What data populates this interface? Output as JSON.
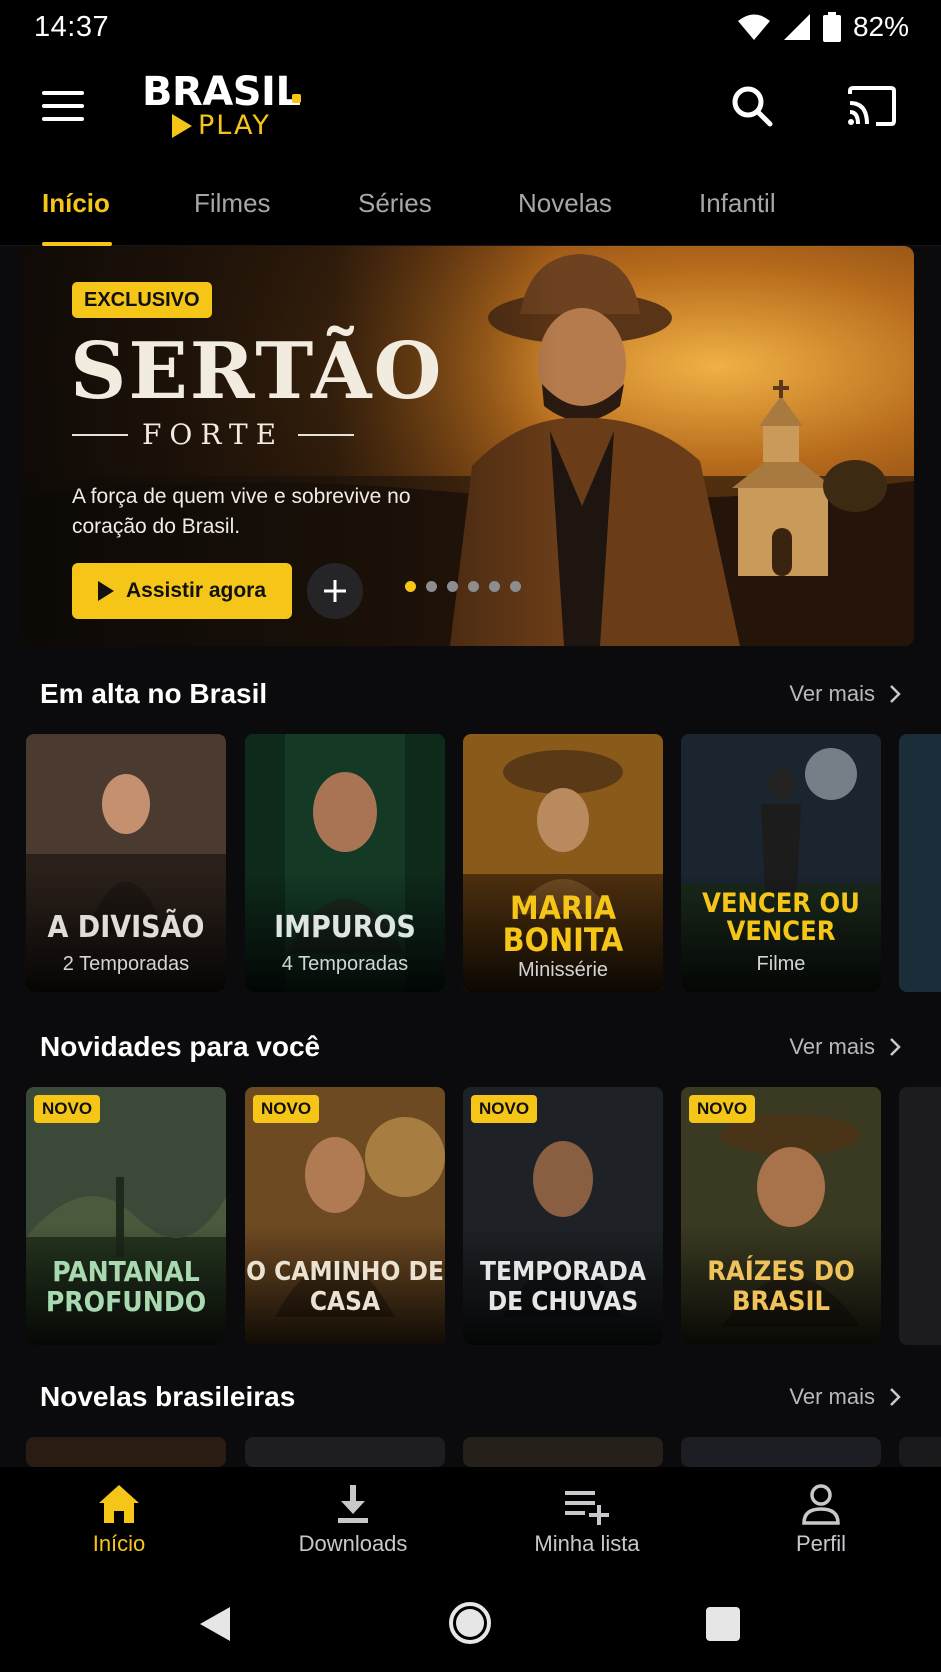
{
  "status_bar": {
    "time": "14:37",
    "battery": "82%"
  },
  "header": {
    "logo_top": "BRASIL",
    "logo_bottom": "PLAY"
  },
  "tabs": [
    {
      "label": "Início",
      "active": true
    },
    {
      "label": "Filmes"
    },
    {
      "label": "Séries"
    },
    {
      "label": "Novelas"
    },
    {
      "label": "Infantil"
    }
  ],
  "hero": {
    "badge": "EXCLUSIVO",
    "title": "SERTÃO",
    "subtitle": "FORTE",
    "description": "A força de quem vive e sobrevive no coração do Brasil.",
    "watch_label": "Assistir agora",
    "add_label": "+",
    "carousel_count": 6,
    "carousel_active": 1
  },
  "sections": {
    "trending": {
      "title": "Em alta no Brasil",
      "see_more": "Ver mais",
      "items": [
        {
          "title": "A DIVISÃO",
          "subtitle": "2 Temporadas"
        },
        {
          "title": "IMPUROS",
          "subtitle": "4 Temporadas"
        },
        {
          "title": "MARIA BONITA",
          "subtitle": "Minissérie"
        },
        {
          "title": "VENCER OU VENCER",
          "subtitle": "Filme"
        }
      ]
    },
    "new_for_you": {
      "title": "Novidades para você",
      "see_more": "Ver mais",
      "badge": "NOVO",
      "items": [
        {
          "title": "PANTANAL PROFUNDO"
        },
        {
          "title": "O CAMINHO DE CASA"
        },
        {
          "title": "TEMPORADA DE CHUVAS"
        },
        {
          "title": "RAÍZES DO BRASIL"
        }
      ]
    },
    "novelas": {
      "title": "Novelas brasileiras",
      "see_more": "Ver mais"
    }
  },
  "bottom_nav": [
    {
      "label": "Início",
      "icon": "home-icon",
      "active": true
    },
    {
      "label": "Downloads",
      "icon": "download-icon"
    },
    {
      "label": "Minha lista",
      "icon": "playlist-add-icon"
    },
    {
      "label": "Perfil",
      "icon": "person-icon"
    }
  ],
  "colors": {
    "accent": "#f5c518",
    "background": "#0b0b0d"
  }
}
